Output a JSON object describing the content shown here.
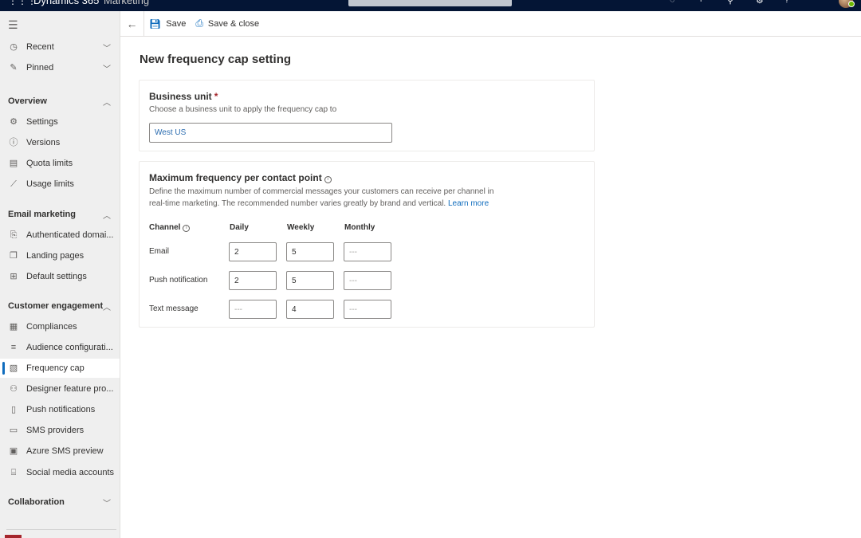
{
  "app": {
    "title": "Dynamics 365",
    "area": "Marketing",
    "waffle_icon": "waffle-icon",
    "top_icons": [
      "lightbulb-icon",
      "add-icon",
      "filter-icon",
      "settings-icon",
      "help-icon"
    ],
    "presence_color": "#6bb700"
  },
  "sidebar": {
    "hamburger_icon": "hamburger-icon",
    "top_items": [
      {
        "label": "Recent",
        "icon": "clock-icon"
      },
      {
        "label": "Pinned",
        "icon": "pin-icon"
      }
    ],
    "groups": [
      {
        "label": "Overview",
        "expanded": true,
        "items": [
          {
            "label": "Settings",
            "icon": "gear-icon"
          },
          {
            "label": "Versions",
            "icon": "info-icon"
          },
          {
            "label": "Quota limits",
            "icon": "quota-icon"
          },
          {
            "label": "Usage limits",
            "icon": "chart-line-icon"
          }
        ]
      },
      {
        "label": "Email marketing",
        "expanded": true,
        "items": [
          {
            "label": "Authenticated domai...",
            "icon": "domain-icon"
          },
          {
            "label": "Landing pages",
            "icon": "pages-icon"
          },
          {
            "label": "Default settings",
            "icon": "default-settings-icon"
          }
        ]
      },
      {
        "label": "Customer engagement",
        "expanded": true,
        "items": [
          {
            "label": "Compliances",
            "icon": "compliance-icon"
          },
          {
            "label": "Audience configurati...",
            "icon": "audience-icon"
          },
          {
            "label": "Frequency cap",
            "icon": "frequency-cap-icon",
            "selected": true
          },
          {
            "label": "Designer feature pro...",
            "icon": "designer-icon"
          },
          {
            "label": "Push notifications",
            "icon": "push-icon"
          },
          {
            "label": "SMS providers",
            "icon": "sms-icon"
          },
          {
            "label": "Azure SMS preview",
            "icon": "azure-sms-icon"
          },
          {
            "label": "Social media accounts",
            "icon": "social-icon"
          }
        ]
      },
      {
        "label": "Collaboration",
        "expanded": false,
        "items": []
      }
    ],
    "accent_color": "#0f6cbd"
  },
  "commandbar": {
    "back_label": "Back",
    "save_label": "Save",
    "save_close_label": "Save & close"
  },
  "page": {
    "title": "New frequency cap setting",
    "business_unit": {
      "label": "Business unit",
      "required_marker": "*",
      "description": "Choose a business unit to apply the frequency cap to",
      "value": "West US"
    },
    "max_frequency": {
      "label": "Maximum frequency per contact point",
      "description_line1": "Define the maximum number of commercial messages your customers can receive per channel in",
      "description_line2": "real-time marketing. The recommended number varies greatly by brand and vertical.",
      "learn_more": "Learn more",
      "columns": [
        "Channel",
        "Daily",
        "Weekly",
        "Monthly"
      ],
      "placeholder": "---",
      "rows": [
        {
          "channel": "Email",
          "daily": "2",
          "weekly": "5",
          "monthly": ""
        },
        {
          "channel": "Push notification",
          "daily": "2",
          "weekly": "5",
          "monthly": ""
        },
        {
          "channel": "Text message",
          "daily": "",
          "weekly": "4",
          "monthly": ""
        }
      ]
    }
  }
}
